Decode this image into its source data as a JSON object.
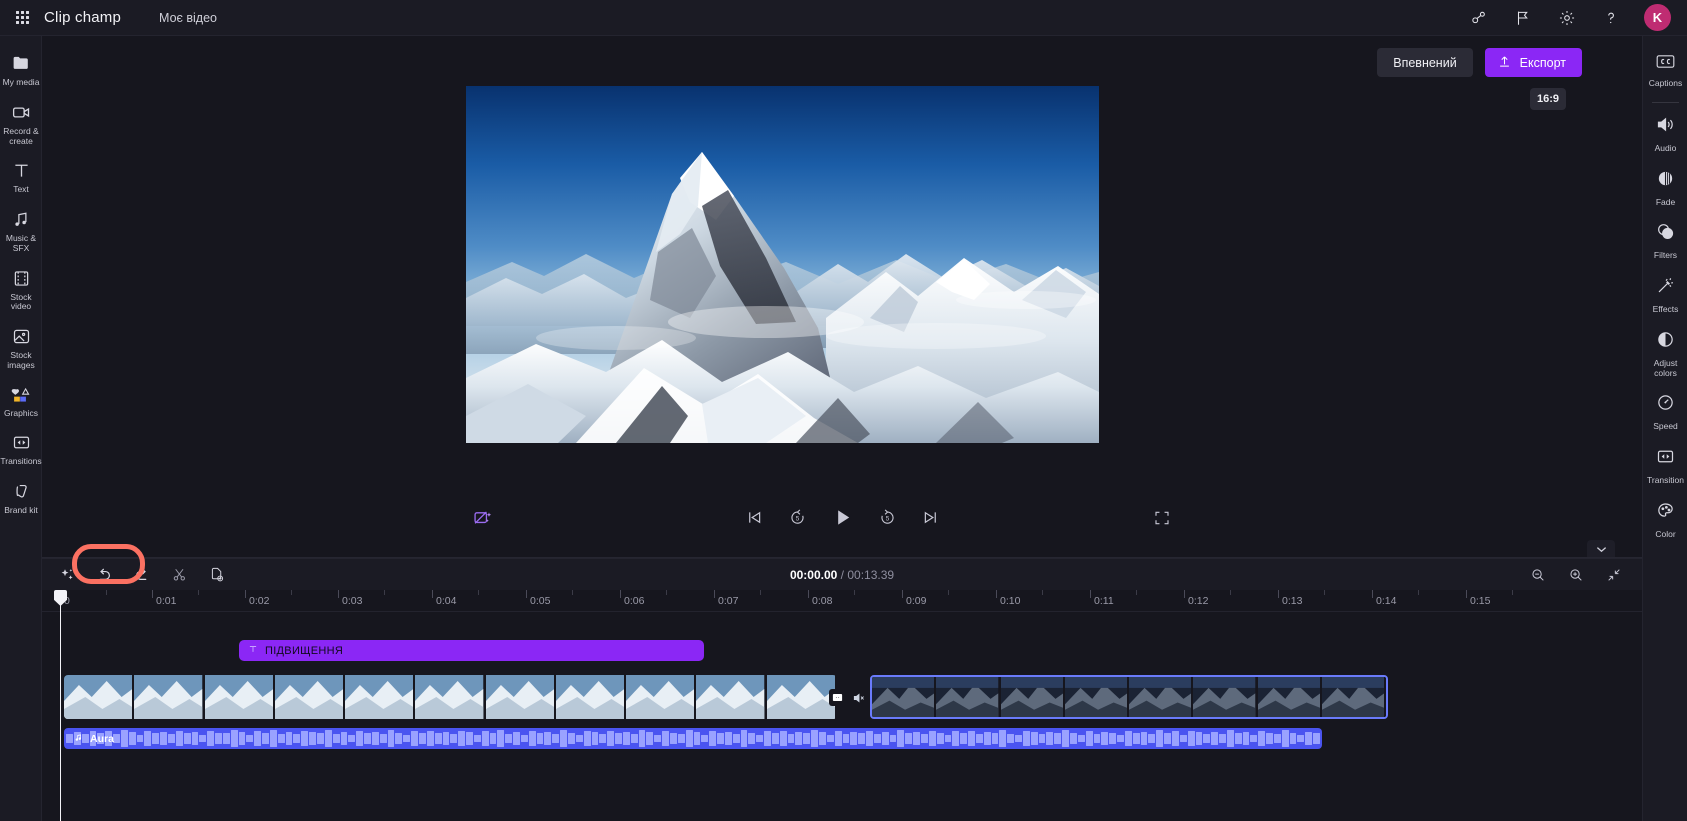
{
  "app": {
    "brand": "Clip champ",
    "project_name": "Моє відео",
    "avatar_initial": "K",
    "accent_purple": "#8b27f5",
    "avatar_color": "#bf2c72",
    "annotation_color": "#fb7162"
  },
  "topbar": {
    "icons": [
      {
        "name": "waffle-icon",
        "label": "app-launcher"
      },
      {
        "name": "share-people-icon",
        "label": "Share"
      },
      {
        "name": "flag-icon",
        "label": "Feedback"
      },
      {
        "name": "gear-icon",
        "label": "Settings"
      },
      {
        "name": "help-icon",
        "label": "?"
      }
    ]
  },
  "left_rail": {
    "items": [
      {
        "label": "My media",
        "icon": "folder-icon"
      },
      {
        "label": "Record &\ncreate",
        "icon": "camera-icon"
      },
      {
        "label": "Text",
        "icon": "text-icon"
      },
      {
        "label": "Music & SFX",
        "icon": "music-icon"
      },
      {
        "label": "Stock video",
        "icon": "film-icon"
      },
      {
        "label": "Stock\nimages",
        "icon": "image-icon"
      },
      {
        "label": "Graphics",
        "icon": "graphics-icon"
      },
      {
        "label": "Transitions",
        "icon": "transition-icon"
      },
      {
        "label": "Brand kit",
        "icon": "brandkit-icon"
      }
    ]
  },
  "right_rail": {
    "items": [
      {
        "label": "Captions",
        "icon": "cc-icon"
      },
      {
        "label": "Audio",
        "icon": "speaker-icon"
      },
      {
        "label": "Fade",
        "icon": "fade-icon"
      },
      {
        "label": "Filters",
        "icon": "filters-icon"
      },
      {
        "label": "Effects",
        "icon": "effects-wand-icon"
      },
      {
        "label": "Adjust\ncolors",
        "icon": "contrast-icon"
      },
      {
        "label": "Speed",
        "icon": "speedometer-icon"
      },
      {
        "label": "Transition",
        "icon": "transition-icon"
      },
      {
        "label": "Color",
        "icon": "palette-icon"
      }
    ]
  },
  "stage": {
    "secondary_button": "Впевнений",
    "export_button": "Експорт",
    "export_icon": "upload-icon",
    "aspect_ratio": "16:9"
  },
  "player": {
    "ai_icon": "magic-remove-bg-icon",
    "controls": [
      {
        "name": "skip-to-start-button",
        "icon": "skip-back-icon"
      },
      {
        "name": "rewind-5-button",
        "icon": "rewind-5-icon"
      },
      {
        "name": "play-button",
        "icon": "play-icon"
      },
      {
        "name": "forward-5-button",
        "icon": "forward-5-icon"
      },
      {
        "name": "skip-to-end-button",
        "icon": "skip-forward-icon"
      }
    ],
    "fullscreen_icon": "fullscreen-icon"
  },
  "timeline": {
    "tools": [
      {
        "name": "magic-tools-button",
        "icon": "sparkle-icon"
      },
      {
        "name": "undo-button",
        "icon": "undo-icon"
      },
      {
        "name": "redo-button",
        "icon": "redo-icon"
      },
      {
        "name": "split-button",
        "icon": "scissors-icon"
      },
      {
        "name": "duplicate-button",
        "icon": "duplicate-icon"
      }
    ],
    "current_time": "00:00.00",
    "separator": "/",
    "total_time": "00:13.39",
    "zoom_tools": [
      {
        "name": "zoom-out-button",
        "icon": "zoom-out-icon"
      },
      {
        "name": "zoom-in-button",
        "icon": "zoom-in-icon"
      },
      {
        "name": "fit-timeline-button",
        "icon": "fit-icon"
      }
    ],
    "ruler_labels": [
      "0",
      "0:01",
      "0:02",
      "0:03",
      "0:04",
      "0:05",
      "0:06",
      "0:07",
      "0:08",
      "0:09",
      "0:10",
      "0:11",
      "0:12",
      "0:13",
      "0:14",
      "0:15"
    ],
    "text_clip": {
      "label": "ПІДВИЩЕННЯ",
      "icon": "text-t-icon"
    },
    "video_clip_1": {
      "name": "video-clip-left"
    },
    "video_clip_2": {
      "name": "video-clip-right-selected"
    },
    "transition_badge_icon": "transition-icon",
    "mute_badge_icon": "speaker-mute-icon",
    "audio_clip": {
      "label": "Aura",
      "icon": "music-note-icon"
    }
  }
}
